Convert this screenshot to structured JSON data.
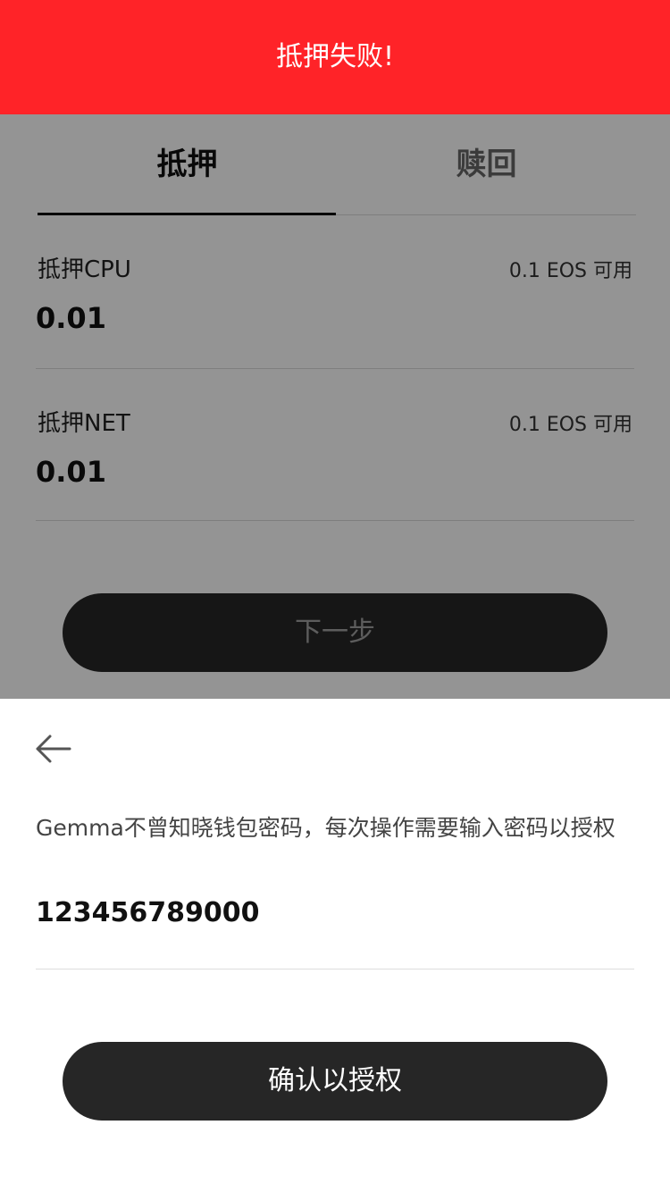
{
  "toast": {
    "message": "抵押失败!"
  },
  "tabs": [
    {
      "label": "抵押",
      "active": true
    },
    {
      "label": "赎回",
      "active": false
    }
  ],
  "stake": {
    "cpu": {
      "label": "抵押CPU",
      "available": "0.1 EOS 可用",
      "value": "0.01"
    },
    "net": {
      "label": "抵押NET",
      "available": "0.1 EOS 可用",
      "value": "0.01"
    }
  },
  "next_button": {
    "label": "下一步"
  },
  "sheet": {
    "back_icon": "arrow-left-icon",
    "tip": "Gemma不曾知晓钱包密码，每次操作需要输入密码以授权",
    "password_value": "123456789000",
    "confirm_label": "确认以授权"
  },
  "colors": {
    "toast_bg": "#ff2328",
    "button_bg": "#262626",
    "overlay": "rgba(0,0,0,0.42)"
  }
}
